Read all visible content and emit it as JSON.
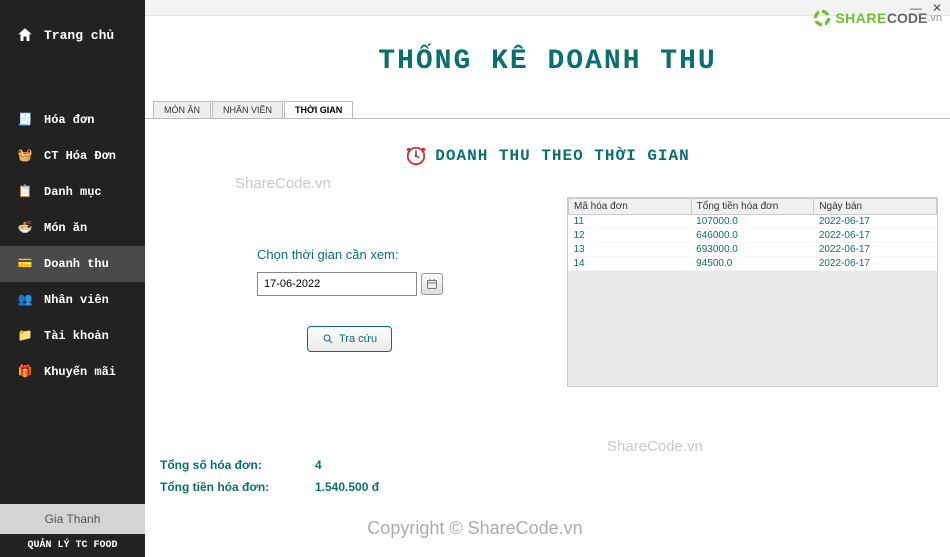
{
  "brand": {
    "text1": "SHARE",
    "text2": "CODE",
    "text3": ".vn"
  },
  "sidebar": {
    "home": "Trang chủ",
    "items": [
      {
        "label": "Hóa đơn",
        "active": false
      },
      {
        "label": "CT Hóa Đơn",
        "active": false
      },
      {
        "label": "Danh mục",
        "active": false
      },
      {
        "label": "Món ăn",
        "active": false
      },
      {
        "label": "Doanh thu",
        "active": true
      },
      {
        "label": "Nhân viên",
        "active": false
      },
      {
        "label": "Tài khoản",
        "active": false
      },
      {
        "label": "Khuyến mãi",
        "active": false
      }
    ],
    "user": "Gia Thanh",
    "footer": "QUẢN LÝ TC FOOD"
  },
  "page": {
    "title": "THỐNG KÊ DOANH THU",
    "tabs": [
      "MÓN ĂN",
      "NHÂN VIÊN",
      "THỜI GIAN"
    ],
    "active_tab": 2,
    "section_title": "DOANH THU THEO THỜI GIAN",
    "form": {
      "label": "Chọn thời gian cần xem:",
      "date": "17-06-2022",
      "search_label": "Tra cứu"
    },
    "table": {
      "columns": [
        "Mã hóa đơn",
        "Tổng tiền hóa đơn",
        "Ngày bán"
      ],
      "rows": [
        [
          "11",
          "107000.0",
          "2022-06-17"
        ],
        [
          "12",
          "646000.0",
          "2022-06-17"
        ],
        [
          "13",
          "693000.0",
          "2022-06-17"
        ],
        [
          "14",
          "94500.0",
          "2022-06-17"
        ]
      ]
    },
    "summary": {
      "count_label": "Tổng số hóa đơn:",
      "count_value": "4",
      "total_label": "Tổng tiền hóa đơn:",
      "total_value": "1.540.500 đ"
    }
  },
  "watermarks": {
    "wm": "ShareCode.vn",
    "copyright": "Copyright © ShareCode.vn"
  }
}
